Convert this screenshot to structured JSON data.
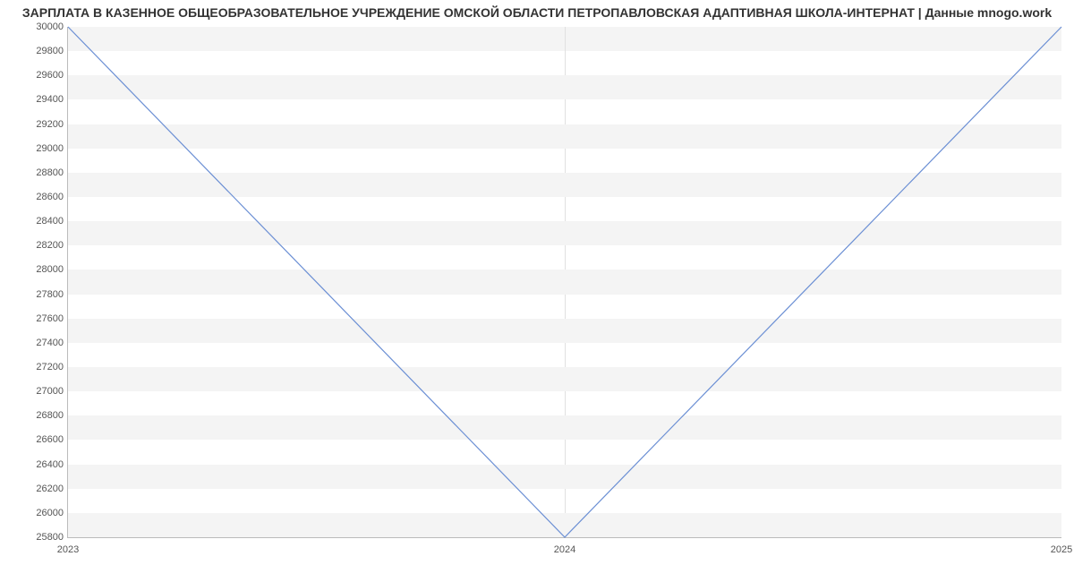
{
  "chart_data": {
    "type": "line",
    "title": "ЗАРПЛАТА В КАЗЕННОЕ ОБЩЕОБРАЗОВАТЕЛЬНОЕ УЧРЕЖДЕНИЕ ОМСКОЙ ОБЛАСТИ ПЕТРОПАВЛОВСКАЯ АДАПТИВНАЯ ШКОЛА-ИНТЕРНАТ | Данные mnogo.work",
    "x": [
      "2023",
      "2024",
      "2025"
    ],
    "values": [
      30000,
      25800,
      30000
    ],
    "xticks": [
      "2023",
      "2024",
      "2025"
    ],
    "yticks": [
      25800,
      26000,
      26200,
      26400,
      26600,
      26800,
      27000,
      27200,
      27400,
      27600,
      27800,
      28000,
      28200,
      28400,
      28600,
      28800,
      29000,
      29200,
      29400,
      29600,
      29800,
      30000
    ],
    "ylim": [
      25800,
      30000
    ],
    "xlabel": "",
    "ylabel": "",
    "line_color": "#6b8fd4",
    "band_color": "#f4f4f4"
  }
}
